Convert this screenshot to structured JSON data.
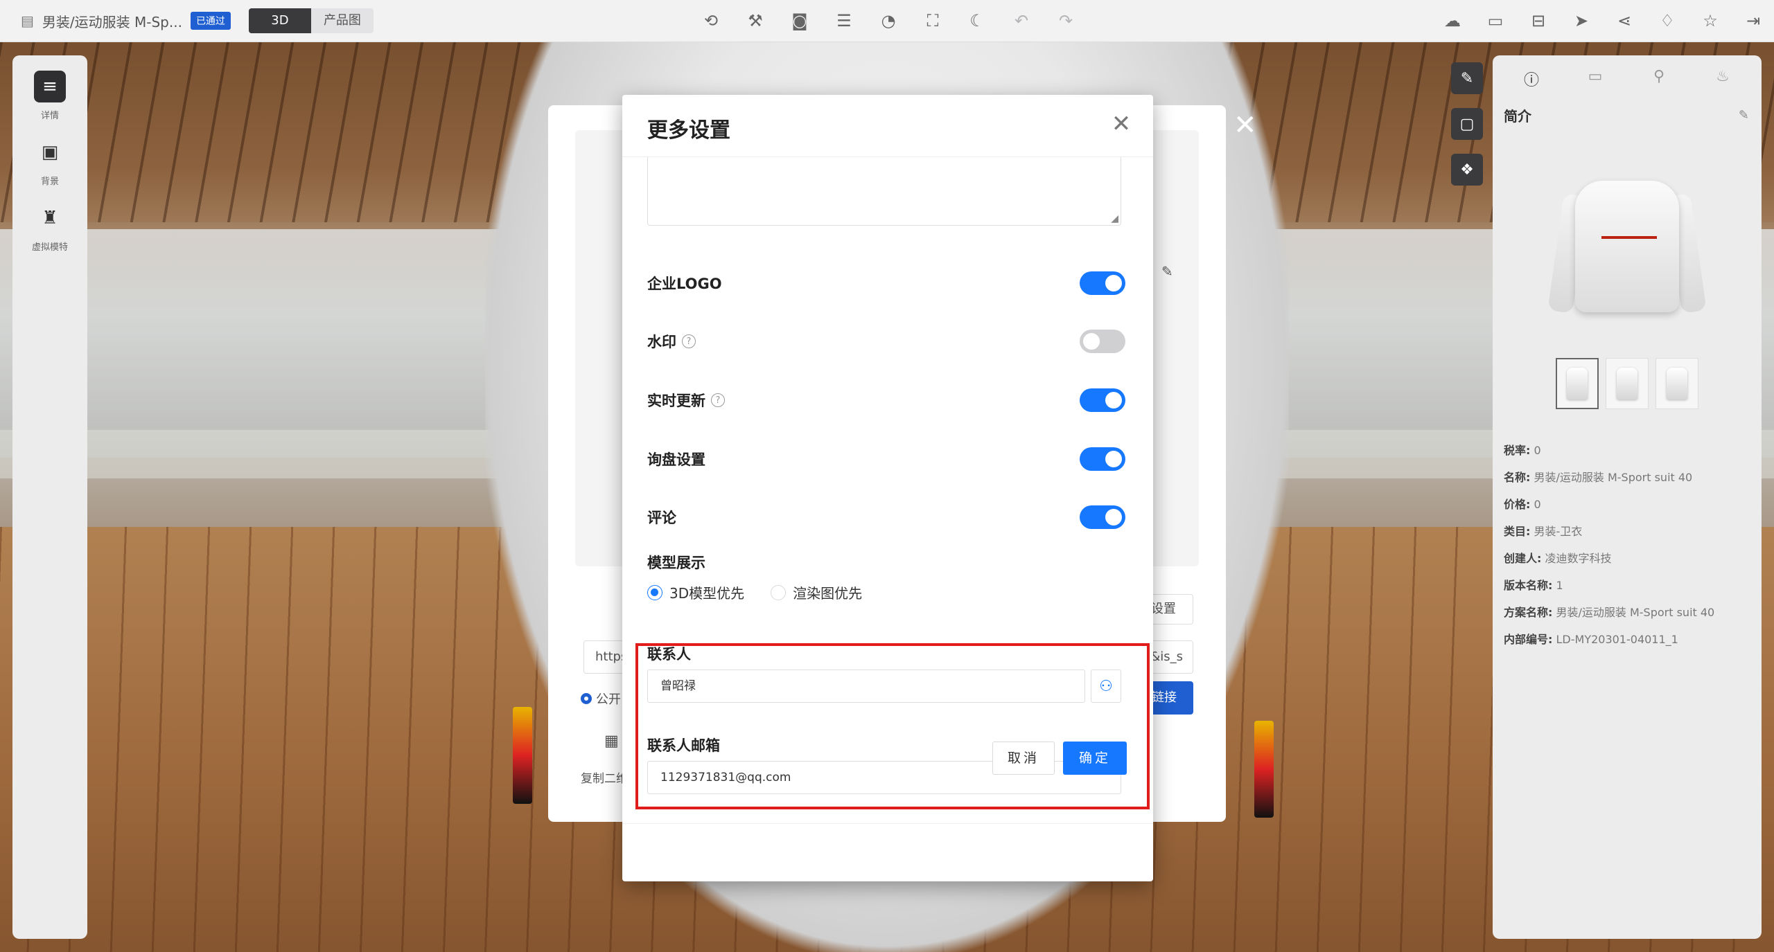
{
  "topbar": {
    "doc_title": "男装/运动服装 M-Sp...",
    "status_badge": "已通过",
    "view_tabs": [
      "3D",
      "产品图"
    ]
  },
  "left_sidebar": {
    "items": [
      {
        "label": "详情",
        "icon": "doc-icon"
      },
      {
        "label": "背景",
        "icon": "image-icon"
      },
      {
        "label": "虚拟模特",
        "icon": "mannequin-icon"
      }
    ]
  },
  "right_panel": {
    "title": "简介",
    "info": [
      {
        "key": "税率:",
        "value": "0"
      },
      {
        "key": "名称:",
        "value": "男装/运动服装 M-Sport suit 40"
      },
      {
        "key": "价格:",
        "value": "0"
      },
      {
        "key": "类目:",
        "value": "男装-卫衣"
      },
      {
        "key": "创建人:",
        "value": "凌迪数字科技"
      },
      {
        "key": "版本名称:",
        "value": "1"
      },
      {
        "key": "方案名称:",
        "value": "男装/运动服装 M-Sport suit 40"
      },
      {
        "key": "内部编号:",
        "value": "LD-MY20301-04011_1"
      }
    ]
  },
  "share_dialog": {
    "settings_button": "设置",
    "url_prefix": "https",
    "url_suffix": "&is_s",
    "copy_link_button": "链接",
    "public_label": "公开",
    "copy_qr_label": "复制二维"
  },
  "modal": {
    "title": "更多设置",
    "settings": [
      {
        "label": "企业LOGO",
        "enabled": true,
        "help": false
      },
      {
        "label": "水印",
        "enabled": false,
        "help": true
      },
      {
        "label": "实时更新",
        "enabled": true,
        "help": true
      },
      {
        "label": "询盘设置",
        "enabled": true,
        "help": false
      },
      {
        "label": "评论",
        "enabled": true,
        "help": false
      }
    ],
    "model_display": {
      "label": "模型展示",
      "options": [
        "3D模型优先",
        "渲染图优先"
      ],
      "selected": "3D模型优先"
    },
    "contact": {
      "label": "联系人",
      "value": "曾昭禄"
    },
    "contact_email": {
      "label": "联系人邮箱",
      "value": "1129371831@qq.com"
    },
    "cancel_label": "取消",
    "ok_label": "确定"
  },
  "colors": {
    "primary": "#1677ff",
    "highlight": "#e21b1b",
    "badge": "#1f5fd1"
  }
}
